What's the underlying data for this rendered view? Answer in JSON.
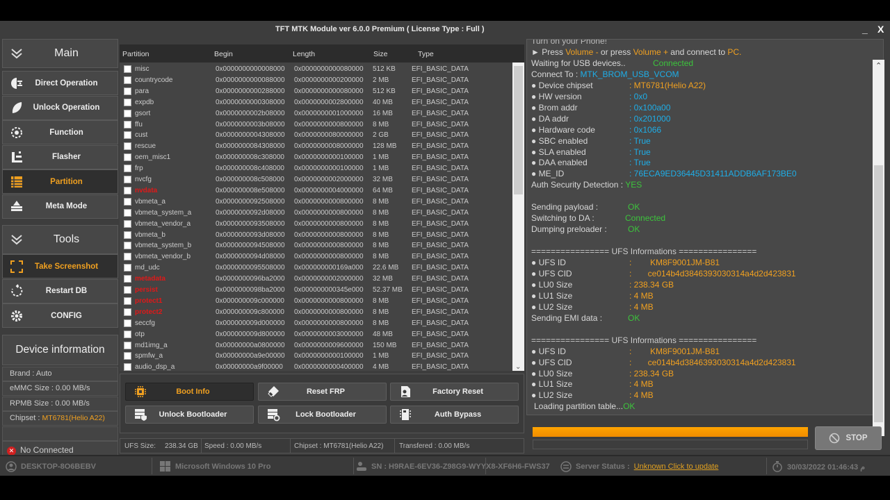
{
  "window": {
    "title": "TFT MTK Module ver 6.0.0 Premium ( License Type : Full )",
    "minimize": "_",
    "close": "X"
  },
  "sidebar": {
    "main_header": "Main",
    "items": [
      {
        "label": "Direct Operation",
        "icon": "direct-operation-icon"
      },
      {
        "label": "Unlock Operation",
        "icon": "leaf-icon"
      },
      {
        "label": "Function",
        "icon": "brain-icon"
      },
      {
        "label": "Flasher",
        "icon": "flasher-icon"
      },
      {
        "label": "Partition",
        "icon": "list-icon",
        "active": true
      },
      {
        "label": "Meta Mode",
        "icon": "meta-mode-icon"
      }
    ],
    "tools_header": "Tools",
    "tools": [
      {
        "label": "Take Screenshot",
        "icon": "screenshot-icon",
        "active": true
      },
      {
        "label": "Restart DB",
        "icon": "restart-icon"
      },
      {
        "label": "CONFIG",
        "icon": "gear-icon"
      }
    ],
    "device_info_header": "Device information",
    "device_info": {
      "brand": "Brand : Auto",
      "emmc": "eMMC Size : 0.00 MB/s",
      "rpmb": "RPMB Size : 0.00 MB/s",
      "chipset_label": "Chipset : ",
      "chipset_value": "MT6781(Helio A22)"
    },
    "connection_status": "No Connected"
  },
  "table": {
    "columns": [
      "Partition",
      "Begin",
      "Length",
      "Size",
      "Type"
    ],
    "rows": [
      {
        "name": "misc",
        "begin": "0x0000000000008000",
        "length": "0x0000000000080000",
        "size": "512 KB",
        "type": "EFI_BASIC_DATA",
        "red": false
      },
      {
        "name": "countrycode",
        "begin": "0x0000000000088000",
        "length": "0x0000000000200000",
        "size": "2 MB",
        "type": "EFI_BASIC_DATA",
        "red": false
      },
      {
        "name": "para",
        "begin": "0x0000000000288000",
        "length": "0x0000000000080000",
        "size": "512 KB",
        "type": "EFI_BASIC_DATA",
        "red": false
      },
      {
        "name": "expdb",
        "begin": "0x0000000000308000",
        "length": "0x0000000002800000",
        "size": "40 MB",
        "type": "EFI_BASIC_DATA",
        "red": false
      },
      {
        "name": "gsort",
        "begin": "0x0000000002b08000",
        "length": "0x0000000001000000",
        "size": "16 MB",
        "type": "EFI_BASIC_DATA",
        "red": false
      },
      {
        "name": "ffu",
        "begin": "0x0000000003b08000",
        "length": "0x0000000000800000",
        "size": "8 MB",
        "type": "EFI_BASIC_DATA",
        "red": false
      },
      {
        "name": "cust",
        "begin": "0x0000000004308000",
        "length": "0x0000000080000000",
        "size": "2 GB",
        "type": "EFI_BASIC_DATA",
        "red": false
      },
      {
        "name": "rescue",
        "begin": "0x0000000084308000",
        "length": "0x0000000008000000",
        "size": "128 MB",
        "type": "EFI_BASIC_DATA",
        "red": false
      },
      {
        "name": "oem_misc1",
        "begin": "0x000000008c308000",
        "length": "0x0000000000100000",
        "size": "1 MB",
        "type": "EFI_BASIC_DATA",
        "red": false
      },
      {
        "name": "frp",
        "begin": "0x000000008c408000",
        "length": "0x0000000000100000",
        "size": "1 MB",
        "type": "EFI_BASIC_DATA",
        "red": false
      },
      {
        "name": "nvcfg",
        "begin": "0x000000008c508000",
        "length": "0x0000000002000000",
        "size": "32 MB",
        "type": "EFI_BASIC_DATA",
        "red": false
      },
      {
        "name": "nvdata",
        "begin": "0x000000008e508000",
        "length": "0x0000000004000000",
        "size": "64 MB",
        "type": "EFI_BASIC_DATA",
        "red": true
      },
      {
        "name": "vbmeta_a",
        "begin": "0x0000000092508000",
        "length": "0x0000000000800000",
        "size": "8 MB",
        "type": "EFI_BASIC_DATA",
        "red": false
      },
      {
        "name": "vbmeta_system_a",
        "begin": "0x0000000092d08000",
        "length": "0x0000000000800000",
        "size": "8 MB",
        "type": "EFI_BASIC_DATA",
        "red": false
      },
      {
        "name": "vbmeta_vendor_a",
        "begin": "0x0000000093508000",
        "length": "0x0000000000800000",
        "size": "8 MB",
        "type": "EFI_BASIC_DATA",
        "red": false
      },
      {
        "name": "vbmeta_b",
        "begin": "0x0000000093d08000",
        "length": "0x0000000000800000",
        "size": "8 MB",
        "type": "EFI_BASIC_DATA",
        "red": false
      },
      {
        "name": "vbmeta_system_b",
        "begin": "0x0000000094508000",
        "length": "0x0000000000800000",
        "size": "8 MB",
        "type": "EFI_BASIC_DATA",
        "red": false
      },
      {
        "name": "vbmeta_vendor_b",
        "begin": "0x0000000094d08000",
        "length": "0x0000000000800000",
        "size": "8 MB",
        "type": "EFI_BASIC_DATA",
        "red": false
      },
      {
        "name": "md_udc",
        "begin": "0x0000000095508000",
        "length": "0x000000000169a000",
        "size": "22.6 MB",
        "type": "EFI_BASIC_DATA",
        "red": false
      },
      {
        "name": "metadata",
        "begin": "0x0000000096ba2000",
        "length": "0x0000000002000000",
        "size": "32 MB",
        "type": "EFI_BASIC_DATA",
        "red": true
      },
      {
        "name": "persist",
        "begin": "0x0000000098ba2000",
        "length": "0x000000000345e000",
        "size": "52.37 MB",
        "type": "EFI_BASIC_DATA",
        "red": true
      },
      {
        "name": "protect1",
        "begin": "0x000000009c000000",
        "length": "0x0000000000800000",
        "size": "8 MB",
        "type": "EFI_BASIC_DATA",
        "red": true
      },
      {
        "name": "protect2",
        "begin": "0x000000009c800000",
        "length": "0x0000000000800000",
        "size": "8 MB",
        "type": "EFI_BASIC_DATA",
        "red": true
      },
      {
        "name": "seccfg",
        "begin": "0x000000009d000000",
        "length": "0x0000000000800000",
        "size": "8 MB",
        "type": "EFI_BASIC_DATA",
        "red": false
      },
      {
        "name": "otp",
        "begin": "0x000000009d800000",
        "length": "0x0000000003000000",
        "size": "48 MB",
        "type": "EFI_BASIC_DATA",
        "red": false
      },
      {
        "name": "md1img_a",
        "begin": "0x00000000a0800000",
        "length": "0x0000000009600000",
        "size": "150 MB",
        "type": "EFI_BASIC_DATA",
        "red": false
      },
      {
        "name": "spmfw_a",
        "begin": "0x00000000a9e00000",
        "length": "0x0000000000100000",
        "size": "1 MB",
        "type": "EFI_BASIC_DATA",
        "red": false
      },
      {
        "name": "audio_dsp_a",
        "begin": "0x00000000a9f00000",
        "length": "0x0000000000400000",
        "size": "4 MB",
        "type": "EFI_BASIC_DATA",
        "red": false
      }
    ]
  },
  "actions": [
    {
      "label": "Boot Info",
      "icon": "chip-icon",
      "selected": true
    },
    {
      "label": "Reset FRP",
      "icon": "eraser-icon"
    },
    {
      "label": "Factory Reset",
      "icon": "factory-reset-icon"
    },
    {
      "label": "Unlock Bootloader",
      "icon": "unlock-bootloader-icon"
    },
    {
      "label": "Lock Bootloader",
      "icon": "lock-bootloader-icon"
    },
    {
      "label": "Auth Bypass",
      "icon": "auth-bypass-icon"
    }
  ],
  "status": {
    "ufs_label": "UFS Size:",
    "ufs_value": "238.34 GB",
    "speed": "Speed : 0.00 MB/s",
    "chipset": "Chipset : MT6781(Helio A22)",
    "transferred": "Transfered :  0.00 MB/s"
  },
  "log": {
    "top_cut": "Turn on your Phone!",
    "press_line": [
      {
        "t": "► Press ",
        "c": ""
      },
      {
        "t": "Volume -",
        "c": "y"
      },
      {
        "t": " or press ",
        "c": ""
      },
      {
        "t": "Volume +",
        "c": "y"
      },
      {
        "t": " and connect to ",
        "c": ""
      },
      {
        "t": "PC.",
        "c": "y"
      }
    ],
    "waiting_label": "Waiting for USB devices..",
    "waiting_value": "Connected",
    "connect_label": "Connect To : ",
    "connect_value": "MTK_BROM_USB_VCOM",
    "device": [
      {
        "k": "● Device chipset",
        "v": ": MT6781(Helio A22)",
        "c": "y"
      },
      {
        "k": "● HW version",
        "v": ": 0x0",
        "c": "b"
      },
      {
        "k": "● Brom addr",
        "v": ": 0x100a00",
        "c": "b"
      },
      {
        "k": "● DA addr",
        "v": ": 0x201000",
        "c": "b"
      },
      {
        "k": "● Hardware code",
        "v": ": 0x1066",
        "c": "b"
      },
      {
        "k": "● SBC enabled",
        "v": ": True",
        "c": "b"
      },
      {
        "k": "● SLA enabled",
        "v": ": True",
        "c": "b"
      },
      {
        "k": "● DAA enabled",
        "v": ": True",
        "c": "b"
      },
      {
        "k": "● ME_ID",
        "v": ": 76ECA9ED36445D31411ADDB6AF173BE0",
        "c": "b"
      }
    ],
    "auth_label": "Auth Security Detection : ",
    "auth_value": "YES",
    "steps": [
      {
        "k": "Sending payload :",
        "v": "OK"
      },
      {
        "k": "Switching to DA :",
        "v": "Connected"
      },
      {
        "k": "Dumping preloader :",
        "v": "OK"
      }
    ],
    "ufs_header": "================ UFS Informations ================",
    "ufs": [
      {
        "k": "● UFS ID",
        "v": ":        KM8F9001JM-B81"
      },
      {
        "k": "● UFS CID",
        "v": ":       ce014b4d3846393030314a4d2d423831"
      },
      {
        "k": "● LU0 Size",
        "v": ": 238.34 GB"
      },
      {
        "k": "● LU1 Size",
        "v": ": 4 MB"
      },
      {
        "k": "● LU2 Size",
        "v": ": 4 MB"
      }
    ],
    "emi_label": "Sending EMI data :",
    "emi_value": "OK",
    "loading_label": "Loading partition table...",
    "loading_value": "OK"
  },
  "progress": {
    "value_percent": 100,
    "secondary_percent": 0,
    "stop_label": "STOP"
  },
  "footer": {
    "computer": "DESKTOP-8O6BEBV",
    "os": "Microsoft Windows 10 Pro",
    "sn": "SN : H9RAE-6EV36-Z98G9-WYYX8-XF6H6-FWS37",
    "server_label": "Server Status : ",
    "server_link": "Unknown Click to update",
    "datetime": "30/03/2022 01:46:43 م"
  },
  "colors": {
    "accent": "#f0a020",
    "ok": "#3cc43c",
    "info": "#1eaee8",
    "danger": "#e01818"
  }
}
